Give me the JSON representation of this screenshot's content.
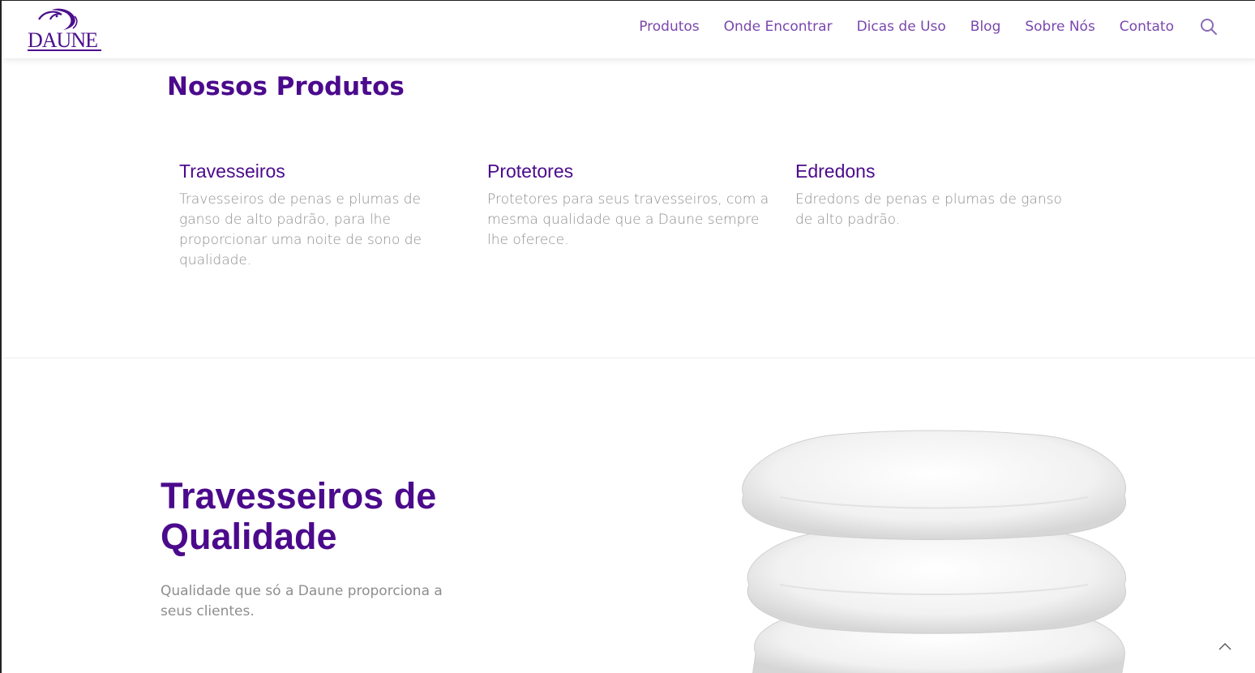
{
  "brand": {
    "logo_text": "DAUNE"
  },
  "nav": {
    "items": [
      {
        "label": "Produtos"
      },
      {
        "label": "Onde Encontrar"
      },
      {
        "label": "Dicas de Uso"
      },
      {
        "label": "Blog"
      },
      {
        "label": "Sobre Nós"
      },
      {
        "label": "Contato"
      }
    ],
    "search_icon": "search-icon"
  },
  "products_section": {
    "title": "Nossos Produtos",
    "items": [
      {
        "title": "Travesseiros",
        "description": "Travesseiros de penas e plumas de ganso de alto padrão, para lhe proporcionar uma noite de sono de qualidade."
      },
      {
        "title": "Protetores",
        "description": "Protetores para seus travesseiros, com a mesma qualidade que a Daune sempre lhe oferece."
      },
      {
        "title": "Edredons",
        "description": "Edredons de penas e plumas de ganso de alto padrão."
      }
    ]
  },
  "hero": {
    "title_line1": "Travesseiros de",
    "title_line2": "Qualidade",
    "subtitle": "Qualidade que só a Daune proporciona a seus clientes."
  },
  "colors": {
    "primary": "#4b0a8c",
    "nav": "#7a47ad",
    "text_muted": "#8e8e8e"
  },
  "scroll_top_icon": "chevron-up-icon"
}
